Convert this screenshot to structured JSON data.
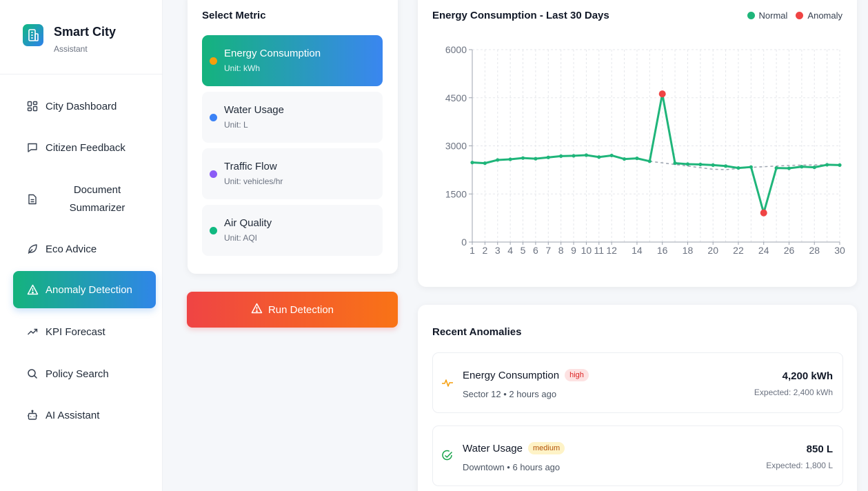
{
  "brand": {
    "title": "Smart City",
    "subtitle": "Assistant"
  },
  "sidebar": {
    "items": [
      {
        "label": "City Dashboard",
        "icon": "grid-icon"
      },
      {
        "label": "Citizen Feedback",
        "icon": "message-icon"
      },
      {
        "label": "Document Summarizer",
        "icon": "document-icon"
      },
      {
        "label": "Eco Advice",
        "icon": "leaf-icon"
      },
      {
        "label": "Anomaly Detection",
        "icon": "warning-icon",
        "active": true
      },
      {
        "label": "KPI Forecast",
        "icon": "trend-up-icon"
      },
      {
        "label": "Policy Search",
        "icon": "search-icon"
      },
      {
        "label": "AI Assistant",
        "icon": "robot-icon"
      }
    ]
  },
  "metrics": {
    "heading": "Select Metric",
    "options": [
      {
        "name": "Energy Consumption",
        "unit": "Unit: kWh",
        "dot_color": "#f59e0b",
        "active": true
      },
      {
        "name": "Water Usage",
        "unit": "Unit: L",
        "dot_color": "#3b82f6"
      },
      {
        "name": "Traffic Flow",
        "unit": "Unit: vehicles/hr",
        "dot_color": "#8b5cf6"
      },
      {
        "name": "Air Quality",
        "unit": "Unit: AQI",
        "dot_color": "#10b981"
      }
    ]
  },
  "run_button": {
    "label": "Run Detection"
  },
  "chart": {
    "legend_normal": "Normal",
    "legend_anomaly": "Anomaly"
  },
  "chart_data": {
    "type": "line",
    "title": "Energy Consumption - Last 30 Days",
    "xlabel": "",
    "ylabel": "",
    "ylim": [
      0,
      6000
    ],
    "yticks": [
      0,
      1500,
      3000,
      4500,
      6000
    ],
    "xticks": [
      1,
      2,
      3,
      4,
      5,
      6,
      7,
      8,
      9,
      10,
      11,
      12,
      14,
      16,
      18,
      20,
      22,
      24,
      26,
      28,
      30
    ],
    "x": [
      1,
      2,
      3,
      4,
      5,
      6,
      7,
      8,
      9,
      10,
      11,
      12,
      13,
      14,
      15,
      16,
      17,
      18,
      19,
      20,
      21,
      22,
      23,
      24,
      25,
      26,
      27,
      28,
      29,
      30
    ],
    "series": [
      {
        "name": "Normal",
        "color": "#1fb57a",
        "values": [
          2480,
          2460,
          2560,
          2580,
          2620,
          2600,
          2640,
          2680,
          2690,
          2710,
          2650,
          2700,
          2590,
          2610,
          2520,
          4620,
          2460,
          2430,
          2420,
          2400,
          2370,
          2310,
          2340,
          910,
          2310,
          2300,
          2350,
          2330,
          2410,
          2400
        ]
      }
    ],
    "expected_line": {
      "values_from_day": 15,
      "values": [
        2520,
        2470,
        2420,
        2370,
        2320,
        2270,
        2260,
        2290,
        2330,
        2350,
        2370,
        2390,
        2400,
        2405,
        2410,
        2400
      ]
    },
    "anomalies": [
      {
        "x": 16,
        "y": 4620,
        "color": "#ef4444"
      },
      {
        "x": 24,
        "y": 910,
        "color": "#ef4444"
      }
    ],
    "grid": true,
    "legend_position": "top-right"
  },
  "recent": {
    "heading": "Recent Anomalies",
    "items": [
      {
        "title": "Energy Consumption",
        "badge": "high",
        "meta": "Sector 12 • 2 hours ago",
        "value": "4,200 kWh",
        "expected": "Expected: 2,400 kWh",
        "icon": "activity-icon"
      },
      {
        "title": "Water Usage",
        "badge": "medium",
        "meta": "Downtown • 6 hours ago",
        "value": "850 L",
        "expected": "Expected: 1,800 L",
        "icon": "check-circle-icon"
      }
    ]
  }
}
